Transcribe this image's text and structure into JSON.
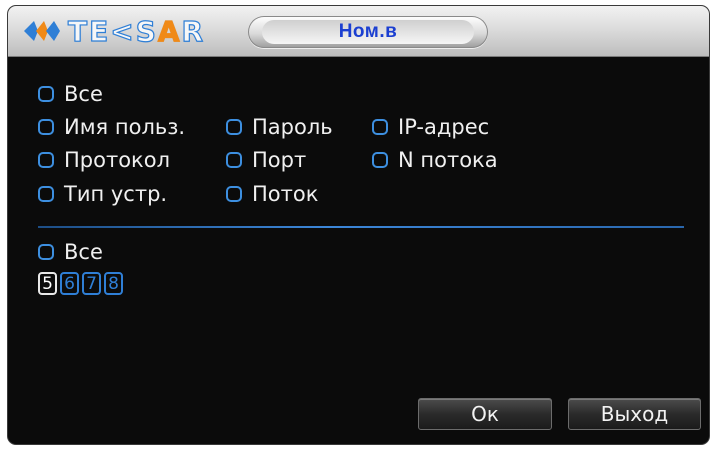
{
  "logo": {
    "text_main": "TE",
    "text_mid": "<S",
    "text_accent": "A",
    "text_end": "R"
  },
  "title": "Ном.в",
  "fields": {
    "all": "Все",
    "username": "Имя польз.",
    "password": "Пароль",
    "ip_address": "IP-адрес",
    "protocol": "Протокол",
    "port": "Порт",
    "stream_no": "N потока",
    "device_type": "Тип устр.",
    "stream": "Поток"
  },
  "channels": {
    "all": "Все",
    "items": [
      "5",
      "6",
      "7",
      "8"
    ],
    "active_index": 0
  },
  "buttons": {
    "ok": "Ок",
    "exit": "Выход"
  },
  "colors": {
    "accent": "#2f7fd6",
    "title": "#1b3fd1",
    "logo_accent": "#f08a18"
  }
}
